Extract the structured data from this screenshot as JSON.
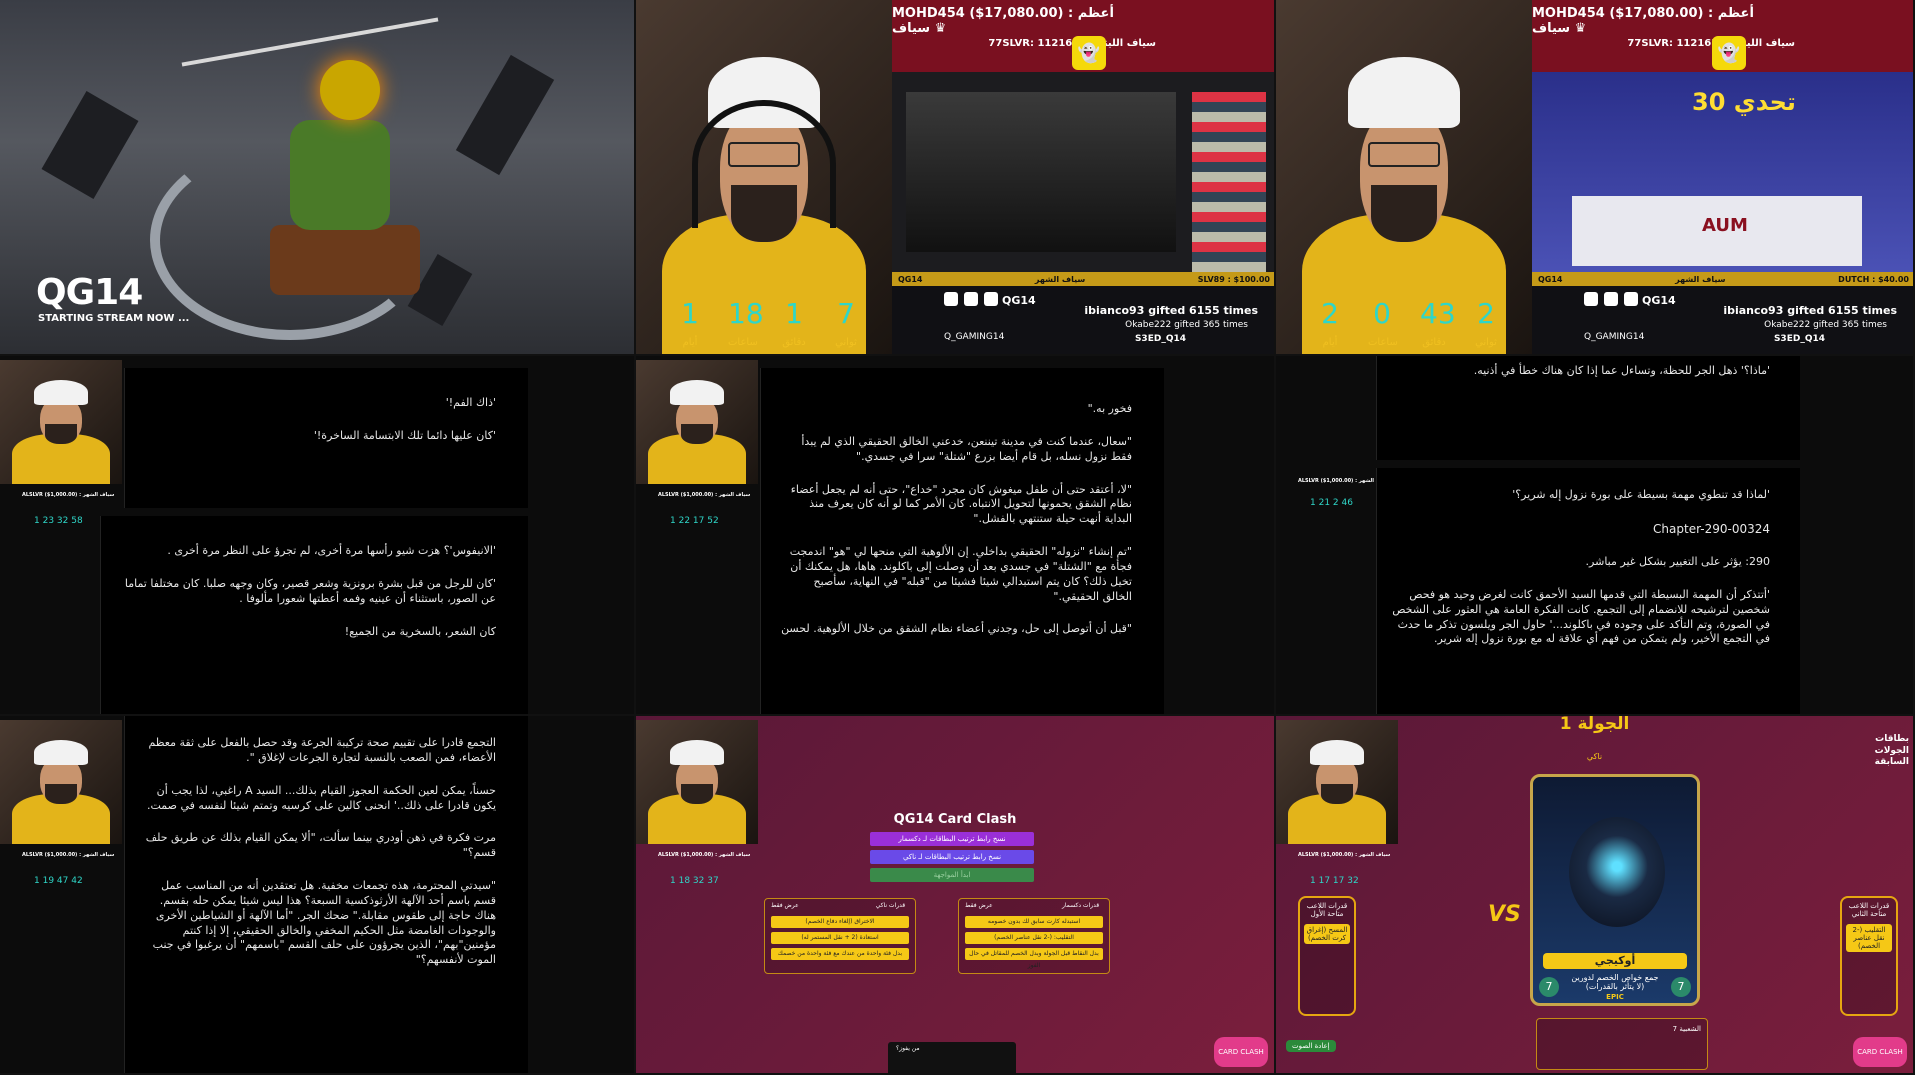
{
  "cells": {
    "anime": {
      "title": "QG14",
      "subtitle": "STARTING STREAM NOW ..."
    },
    "stream1": {
      "timer": [
        "1",
        "18",
        "1",
        "7"
      ],
      "timer_labels": [
        "أيام",
        "ساعات",
        "دقائق",
        "ثواني"
      ],
      "top_line1": "MOHD454 ($17,080.00) : أعظم سياف ♛",
      "top_line2": "77SLVR: 1121654  سياف الليتس",
      "brand": "QG14",
      "social": "Q_GAMING14",
      "gift_line1": "ibianco93 gifted 6155 times",
      "gift_line2": "Okabe222 gifted 365 times",
      "gift_line3": "S3ED_Q14",
      "marquee_left": "QG14",
      "marquee_mid": "سياف الشهر",
      "marquee_right": "SLV89 : $100.00"
    },
    "stream2": {
      "timer": [
        "2",
        "0",
        "43",
        "2"
      ],
      "timer_labels": [
        "أيام",
        "ساعات",
        "دقائق",
        "ثواني"
      ],
      "top_line1": "MOHD454 ($17,080.00) : أعظم سياف ♛",
      "top_line2": "77SLVR: 1121654  سياف الليتس",
      "brand": "QG14",
      "social": "Q_GAMING14",
      "gift_line1": "ibianco93 gifted 6155 times",
      "gift_line2": "Okabe222 gifted 365 times",
      "gift_line3": "S3ED_Q14",
      "marquee_left": "QG14",
      "marquee_mid": "سياف الشهر",
      "marquee_right": "DUTCH : $40.00",
      "studio_logo": "تحدي 30",
      "studio_aum": "AUM"
    },
    "read1": {
      "timer": "1  23  32  58",
      "sub": "ALSLVR ($1,000.00) : سياف الشهر",
      "paras_top": [
        "'ذاك الفم!'",
        "'كان عليها دائما تلك الابتسامة الساخرة!'"
      ],
      "paras_bottom": [
        "'الانيفوس'؟ هزت شيو رأسها مرة أخرى، لم تجرؤ على النظر مرة أخرى .",
        "'كان للرجل من قبل بشرة برونزية وشعر قصير، وكان وجهه صلبا. كان مختلفا تماما عن الصور، باستثناء أن عينيه وفمه أعطتها شعورا مألوفا .",
        "كان الشعر، بالسخرية من الجميع!"
      ]
    },
    "read2": {
      "timer": "1  22  17  52",
      "sub": "ALSLVR ($1,000.00) : سياف الشهر",
      "paras": [
        "فخور به.\"",
        "\"سعال، عندما كنت في مدينة تيننعن، خدعني الخالق الحقيقي الذي لم يبدأ فقط نزول نسله، بل قام أيضا بزرع \"شتلة\" سرا في جسدي.\"",
        "\"لا، أعتقد حتى أن طفل ميغوش كان مجرد \"خداع\"، حتى أنه لم يجعل أعضاء نظام الشقق يحمونها لتحويل الانتباه. كان الأمر كما لو أنه كان يعرف منذ البداية أنهت حيلة ستنتهي بالفشل.\"",
        "\"تم إنشاء \"نزوله\" الحقيقي بداخلي. إن الألوهية التي منحها لي \"هو\" اندمجت فجأة مع \"الشتلة\" في جسدي بعد أن وصلت إلى باكلوند. هاها، هل يمكنك أن تخيل ذلك؟ كان يتم استبدالي شيئا فشيئا من \"قبله\" في النهاية، سأصبح الخالق الحقيقي.\"",
        "\"قبل أن أتوصل إلى حل، وجدني أعضاء نظام الشقق من خلال الألوهية. لحسن"
      ]
    },
    "read3": {
      "timer": "1  21  2  46",
      "sub": "ALSLVR ($1,000.00) : سياف الشهر",
      "para_top": "'ماذا؟' ذهل الجر للحظة، وتساءل عما إذا كان هناك خطأ في أذنيه.",
      "paras": [
        "'لماذا قد تنطوي مهمة بسيطة على بورة نزول إله شرير؟'",
        "Chapter-290-00324",
        "290: يؤثر على التغيير بشكل غير مباشر.",
        "'أتتذكر أن المهمة البسيطة التي قدمها السيد الأحمق كانت لغرض وحيد هو فحص شخصين لترشيحه للانضمام إلى التجمع. كانت الفكرة العامة هي العثور على الشخص في الصورة، وتم التأكد على وجوده في باكلوند...' حاول الجر ويلسون تذكر ما حدث في التجمع الأخير، ولم يتمكن من فهم أي علاقة له مع بورة نزول إله شرير."
      ]
    },
    "read4": {
      "timer": "1  19  47  42",
      "sub": "ALSLVR ($1,000.00) : سياف الشهر",
      "paras": [
        "التجمع قادرا على تقييم صحة تركيبة الجرعة وقد حصل بالفعل على ثقة معظم الأعضاء، فمن الصعب بالنسبة لتجارة الجرعات لإغلاق \".",
        "حسناً، يمكن لعين الحكمة العجوز القيام بذلك... السيد A راغبي، لذا يجب أن يكون قادرا على ذلك..' انحنى كالين على كرسيه وتمتم شيئا لنفسه في صمت.",
        "مرت فكرة في ذهن أودري بينما سألت، \"ألا يمكن القيام بذلك عن طريق حلف قسم؟\"",
        "\"سيدتي المحترمة، هذه تجمعات مخفية. هل تعتقدين أنه من المناسب عمل قسم باسم أحد الآلهة الأرثوذكسية السبعة؟ هذا ليس شيئا يمكن حله بقسم. هناك حاجة إلى طقوس مقابلة.\" ضحك الجر. \"أما الآلهة أو الشياطين الأخرى والوجودات الغامضة مثل الحكيم المخفي والخالق الحقيقي، إلا إذا كنتم مؤمنين\"بهم\"، الذين يجرؤون على حلف القسم \"باسمهم\" أن يرغبوا في جنب الموت لأنفسهم؟\""
      ]
    },
    "clash": {
      "timer": "1  18  32  37",
      "sub": "ALSLVR ($1,000.00) : سياف الشهر",
      "title": "QG14 Card Clash",
      "btn1": "نسخ رابط ترتيب البطاقات لـ دكسمار",
      "btn2": "نسخ رابط ترتيب البطاقات لـ ناكي",
      "btn3": "ابدأ المواجهة",
      "panel_left_title": "قدرات ناكي",
      "panel_left_items": [
        "الاختراق (إلغاء دفاع الخصم)",
        "استعادة (2 + نقل المستمر له)",
        "بدل فئة واحدة من عندك مع فئة واحدة من خصمك"
      ],
      "panel_right_title": "قدرات دكسمار",
      "panel_right_items": [
        "استبدله كارت سابق لك بدون خصومه",
        "التقليب: (-2 نقل عناصر الخصم)",
        "بدل النقاط قبل الجولة وبدل الخصم للمقاتل في حال الفوز"
      ],
      "panel_left_tag": "عرض فقط",
      "panel_right_tag": "عرض فقط",
      "mini_text": "من يفوز؟",
      "badge": "CARD CLASH"
    },
    "battle": {
      "timer": "1  17  17  32",
      "sub": "ALSLVR ($1,000.00) : سياف الشهر",
      "round": "الجولة 1",
      "player": "ناكي",
      "vs": "VS",
      "card_name": "أوكيجي",
      "card_sub": "جمع خواص الخصم لدورين",
      "card_sub2": "(لا يتأثر بالقدرات)",
      "card_rank": "EPIC",
      "card_lv_left": "7",
      "card_lv_right": "7",
      "prev": "بطاقات\nالجولات\nالسابقة",
      "left_box_title": "قدرات اللاعب متاحة الأول",
      "left_box_item": "المسح (إغراق كرت الخصم)",
      "right_box_title": "قدرات اللاعب متاحة الثاني",
      "right_box_item": "التقليب (-2 نقل عناصر الخصم)",
      "vote_btn": "إعادة الصوت",
      "popularity": "الشعبية 7",
      "badge": "CARD CLASH"
    }
  },
  "colors": {
    "accent_yellow": "#f5c816",
    "timer_teal": "#2fd6c8",
    "maroon": "#7a1e3c"
  }
}
